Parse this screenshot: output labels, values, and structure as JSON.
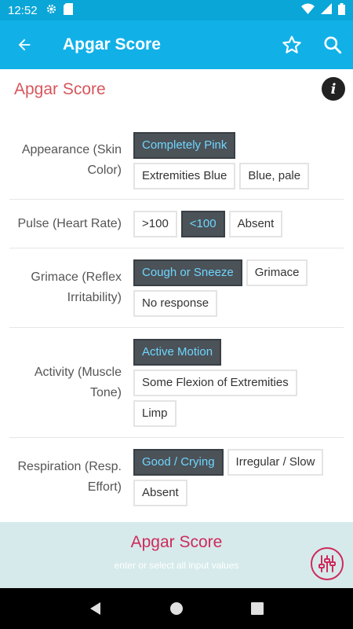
{
  "status": {
    "time": "12:52"
  },
  "appbar": {
    "title": "Apgar Score"
  },
  "section": {
    "title": "Apgar Score"
  },
  "rows": [
    {
      "label": "Appearance (Skin Color)",
      "options": [
        "Completely Pink",
        "Extremities Blue",
        "Blue, pale"
      ],
      "selected": 0
    },
    {
      "label": "Pulse (Heart Rate)",
      "options": [
        ">100",
        "<100",
        "Absent"
      ],
      "selected": 1
    },
    {
      "label": "Grimace (Reflex Irritability)",
      "options": [
        "Cough or Sneeze",
        "Grimace",
        "No response"
      ],
      "selected": 0
    },
    {
      "label": "Activity (Muscle Tone)",
      "options": [
        "Active Motion",
        "Some Flexion of Extremities",
        "Limp"
      ],
      "selected": 0
    },
    {
      "label": "Respiration (Resp. Effort)",
      "options": [
        "Good / Crying",
        "Irregular / Slow",
        "Absent"
      ],
      "selected": 0
    }
  ],
  "result": {
    "title": "Apgar Score",
    "hint": "enter or select all input values"
  },
  "colors": {
    "appbar": "#11b1e8",
    "statusbar": "#0aa6d8",
    "accent_title": "#d8565c",
    "result_title": "#cf2a5b",
    "selected_bg": "#4b5258",
    "selected_text": "#6fd6ff",
    "result_bg": "#d6eaeb"
  },
  "icons": {
    "back": "arrow-left-icon",
    "favorite": "star-outline-icon",
    "search": "search-icon",
    "info": "info-icon",
    "tune": "tune-sliders-icon"
  }
}
